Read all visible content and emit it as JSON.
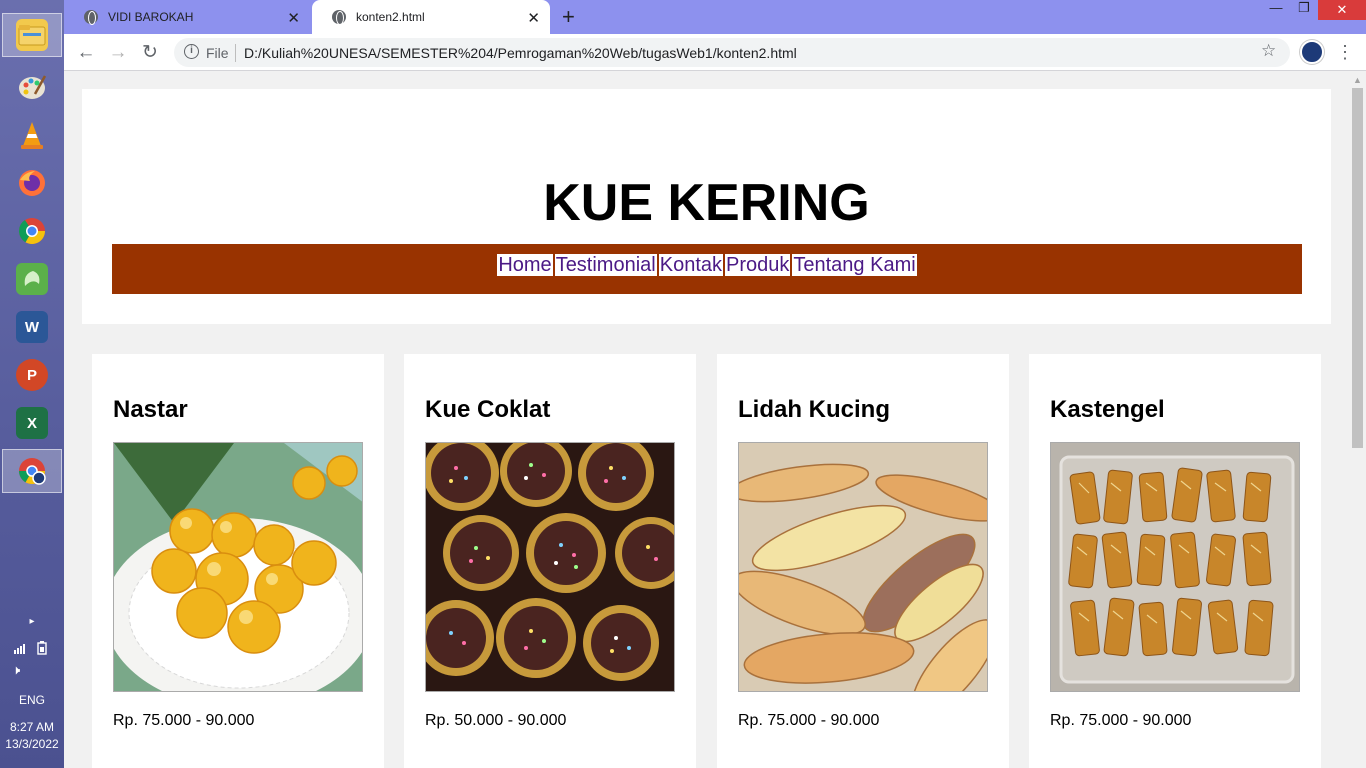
{
  "taskbar": {
    "apps": [
      "File Explorer",
      "Paint",
      "VLC",
      "Firefox",
      "Chrome",
      "Camtasia",
      "Word",
      "PowerPoint",
      "Excel",
      "Chrome (profile)"
    ],
    "language": "ENG",
    "time": "8:27 AM",
    "date": "13/3/2022"
  },
  "browser": {
    "tabs": [
      {
        "title": "VIDI BAROKAH"
      },
      {
        "title": "konten2.html"
      }
    ],
    "omnibox": {
      "label": "File",
      "url": "D:/Kuliah%20UNESA/SEMESTER%204/Pemrogaman%20Web/tugasWeb1/konten2.html"
    }
  },
  "page": {
    "title": "KUE KERING",
    "nav": [
      "Home",
      "Testimonial",
      "Kontak",
      "Produk",
      "Tentang Kami"
    ],
    "products": [
      {
        "name": "Nastar",
        "price": "Rp. 75.000 - 90.000"
      },
      {
        "name": "Kue Coklat",
        "price": "Rp. 50.000 - 90.000"
      },
      {
        "name": "Lidah Kucing",
        "price": "Rp. 75.000 - 90.000"
      },
      {
        "name": "Kastengel",
        "price": "Rp. 75.000 - 90.000"
      }
    ]
  },
  "colors": {
    "nav_bar": "#993300",
    "nav_link": "#4b1a86",
    "tab_strip": "#8d91ee"
  }
}
